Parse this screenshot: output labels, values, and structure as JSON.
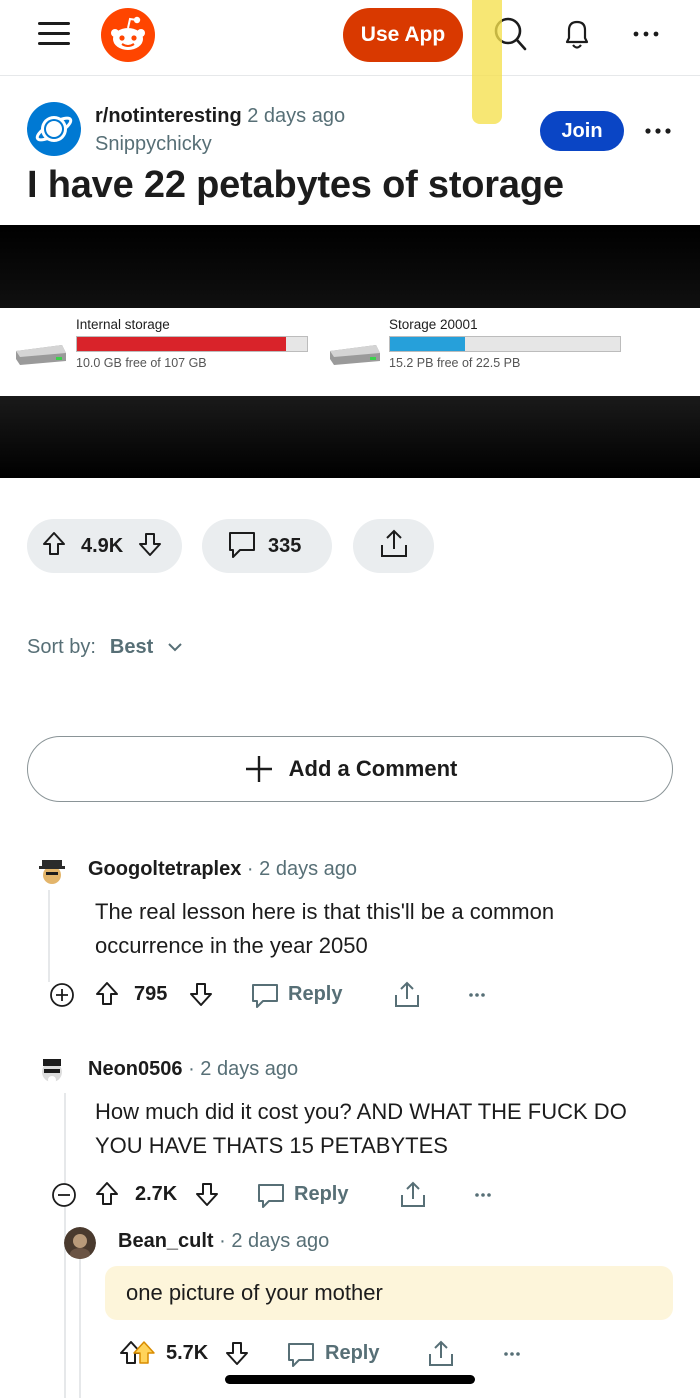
{
  "header": {
    "use_app_label": "Use App"
  },
  "post": {
    "subreddit": "r/notinteresting",
    "time": "2 days ago",
    "author": "Snippychicky",
    "join_label": "Join",
    "title": "I have 22 petabytes of storage",
    "media": {
      "drives": [
        {
          "label": "Internal storage",
          "free_text": "10.0 GB free of 107 GB",
          "used_fraction": 0.907,
          "bar_color": "#d9232a"
        },
        {
          "label": "Storage 20001",
          "free_text": "15.2 PB free of 22.5 PB",
          "used_fraction": 0.324,
          "bar_color": "#26a0da"
        }
      ]
    },
    "votes": "4.9K",
    "comments_count": "335"
  },
  "sort": {
    "label": "Sort by:",
    "value": "Best"
  },
  "add_comment_label": "Add a Comment",
  "comments": [
    {
      "user": "Googoltetraplex",
      "time": "2 days ago",
      "body": "The real lesson here is that this'll be a common occurrence in the year 2050",
      "votes": "795",
      "reply_label": "Reply"
    },
    {
      "user": "Neon0506",
      "time": "2 days ago",
      "body": "How much did it cost you? AND WHAT THE FUCK DO YOU HAVE THATS 15 PETABYTES",
      "votes": "2.7K",
      "reply_label": "Reply"
    },
    {
      "user": "Bean_cult",
      "time": "2 days ago",
      "body": "one picture of your mother",
      "votes": "5.7K",
      "reply_label": "Reply"
    }
  ],
  "colors": {
    "brand_orange": "#ff4500",
    "use_app_bg": "#d93900",
    "join_bg": "#0a45c5",
    "muted_text": "#576f76",
    "pill_bg": "#eaedef"
  }
}
